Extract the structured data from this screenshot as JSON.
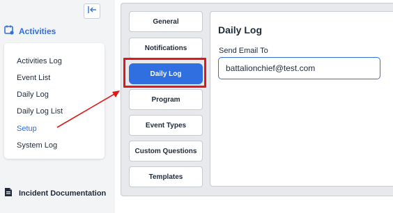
{
  "sidebar": {
    "collapse_icon": "collapse-left-icon",
    "section": {
      "label": "Activities",
      "icon": "calendar-icon"
    },
    "items": [
      {
        "label": "Activities Log",
        "active": false
      },
      {
        "label": "Event List",
        "active": false
      },
      {
        "label": "Daily Log",
        "active": false
      },
      {
        "label": "Daily Log List",
        "active": false
      },
      {
        "label": "Setup",
        "active": true
      },
      {
        "label": "System Log",
        "active": false
      }
    ],
    "incident": {
      "label": "Incident Documentation",
      "icon": "document-icon"
    }
  },
  "settings_nav": {
    "tabs": [
      {
        "label": "General",
        "active": false
      },
      {
        "label": "Notifications",
        "active": false
      },
      {
        "label": "Daily Log",
        "active": true
      },
      {
        "label": "Program",
        "active": false
      },
      {
        "label": "Event Types",
        "active": false
      },
      {
        "label": "Custom Questions",
        "active": false
      },
      {
        "label": "Templates",
        "active": false
      }
    ]
  },
  "daily_log": {
    "title": "Daily Log",
    "send_email_label": "Send Email To",
    "send_email_value": "battalionchief@test.com"
  },
  "colors": {
    "accent": "#2f6fe0",
    "highlight": "#e0181a",
    "arrow": "#e0181a"
  }
}
